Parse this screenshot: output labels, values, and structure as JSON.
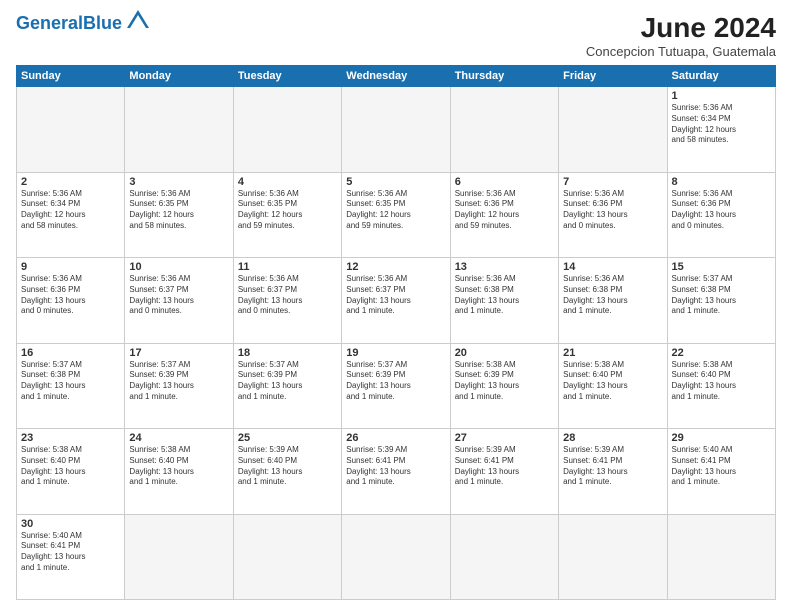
{
  "header": {
    "logo_text_normal": "General",
    "logo_text_colored": "Blue",
    "title": "June 2024",
    "subtitle": "Concepcion Tutuapa, Guatemala"
  },
  "weekdays": [
    "Sunday",
    "Monday",
    "Tuesday",
    "Wednesday",
    "Thursday",
    "Friday",
    "Saturday"
  ],
  "weeks": [
    [
      {
        "day": "",
        "info": ""
      },
      {
        "day": "",
        "info": ""
      },
      {
        "day": "",
        "info": ""
      },
      {
        "day": "",
        "info": ""
      },
      {
        "day": "",
        "info": ""
      },
      {
        "day": "",
        "info": ""
      },
      {
        "day": "1",
        "info": "Sunrise: 5:36 AM\nSunset: 6:34 PM\nDaylight: 12 hours\nand 58 minutes."
      }
    ],
    [
      {
        "day": "2",
        "info": "Sunrise: 5:36 AM\nSunset: 6:34 PM\nDaylight: 12 hours\nand 58 minutes."
      },
      {
        "day": "3",
        "info": "Sunrise: 5:36 AM\nSunset: 6:35 PM\nDaylight: 12 hours\nand 58 minutes."
      },
      {
        "day": "4",
        "info": "Sunrise: 5:36 AM\nSunset: 6:35 PM\nDaylight: 12 hours\nand 59 minutes."
      },
      {
        "day": "5",
        "info": "Sunrise: 5:36 AM\nSunset: 6:35 PM\nDaylight: 12 hours\nand 59 minutes."
      },
      {
        "day": "6",
        "info": "Sunrise: 5:36 AM\nSunset: 6:36 PM\nDaylight: 12 hours\nand 59 minutes."
      },
      {
        "day": "7",
        "info": "Sunrise: 5:36 AM\nSunset: 6:36 PM\nDaylight: 13 hours\nand 0 minutes."
      },
      {
        "day": "8",
        "info": "Sunrise: 5:36 AM\nSunset: 6:36 PM\nDaylight: 13 hours\nand 0 minutes."
      }
    ],
    [
      {
        "day": "9",
        "info": "Sunrise: 5:36 AM\nSunset: 6:36 PM\nDaylight: 13 hours\nand 0 minutes."
      },
      {
        "day": "10",
        "info": "Sunrise: 5:36 AM\nSunset: 6:37 PM\nDaylight: 13 hours\nand 0 minutes."
      },
      {
        "day": "11",
        "info": "Sunrise: 5:36 AM\nSunset: 6:37 PM\nDaylight: 13 hours\nand 0 minutes."
      },
      {
        "day": "12",
        "info": "Sunrise: 5:36 AM\nSunset: 6:37 PM\nDaylight: 13 hours\nand 1 minute."
      },
      {
        "day": "13",
        "info": "Sunrise: 5:36 AM\nSunset: 6:38 PM\nDaylight: 13 hours\nand 1 minute."
      },
      {
        "day": "14",
        "info": "Sunrise: 5:36 AM\nSunset: 6:38 PM\nDaylight: 13 hours\nand 1 minute."
      },
      {
        "day": "15",
        "info": "Sunrise: 5:37 AM\nSunset: 6:38 PM\nDaylight: 13 hours\nand 1 minute."
      }
    ],
    [
      {
        "day": "16",
        "info": "Sunrise: 5:37 AM\nSunset: 6:38 PM\nDaylight: 13 hours\nand 1 minute."
      },
      {
        "day": "17",
        "info": "Sunrise: 5:37 AM\nSunset: 6:39 PM\nDaylight: 13 hours\nand 1 minute."
      },
      {
        "day": "18",
        "info": "Sunrise: 5:37 AM\nSunset: 6:39 PM\nDaylight: 13 hours\nand 1 minute."
      },
      {
        "day": "19",
        "info": "Sunrise: 5:37 AM\nSunset: 6:39 PM\nDaylight: 13 hours\nand 1 minute."
      },
      {
        "day": "20",
        "info": "Sunrise: 5:38 AM\nSunset: 6:39 PM\nDaylight: 13 hours\nand 1 minute."
      },
      {
        "day": "21",
        "info": "Sunrise: 5:38 AM\nSunset: 6:40 PM\nDaylight: 13 hours\nand 1 minute."
      },
      {
        "day": "22",
        "info": "Sunrise: 5:38 AM\nSunset: 6:40 PM\nDaylight: 13 hours\nand 1 minute."
      }
    ],
    [
      {
        "day": "23",
        "info": "Sunrise: 5:38 AM\nSunset: 6:40 PM\nDaylight: 13 hours\nand 1 minute."
      },
      {
        "day": "24",
        "info": "Sunrise: 5:38 AM\nSunset: 6:40 PM\nDaylight: 13 hours\nand 1 minute."
      },
      {
        "day": "25",
        "info": "Sunrise: 5:39 AM\nSunset: 6:40 PM\nDaylight: 13 hours\nand 1 minute."
      },
      {
        "day": "26",
        "info": "Sunrise: 5:39 AM\nSunset: 6:41 PM\nDaylight: 13 hours\nand 1 minute."
      },
      {
        "day": "27",
        "info": "Sunrise: 5:39 AM\nSunset: 6:41 PM\nDaylight: 13 hours\nand 1 minute."
      },
      {
        "day": "28",
        "info": "Sunrise: 5:39 AM\nSunset: 6:41 PM\nDaylight: 13 hours\nand 1 minute."
      },
      {
        "day": "29",
        "info": "Sunrise: 5:40 AM\nSunset: 6:41 PM\nDaylight: 13 hours\nand 1 minute."
      }
    ],
    [
      {
        "day": "30",
        "info": "Sunrise: 5:40 AM\nSunset: 6:41 PM\nDaylight: 13 hours\nand 1 minute."
      },
      {
        "day": "",
        "info": ""
      },
      {
        "day": "",
        "info": ""
      },
      {
        "day": "",
        "info": ""
      },
      {
        "day": "",
        "info": ""
      },
      {
        "day": "",
        "info": ""
      },
      {
        "day": "",
        "info": ""
      }
    ]
  ]
}
